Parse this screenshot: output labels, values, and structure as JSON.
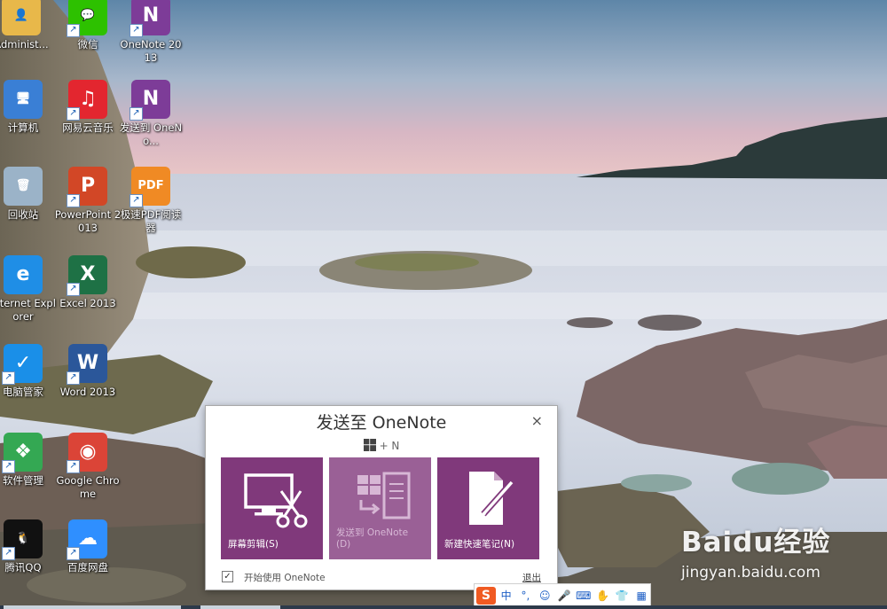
{
  "desktop_icons": [
    {
      "id": "admin",
      "label": "Administ...",
      "icon": "user-folder-icon",
      "color": "#e8b84a",
      "shortcut": false
    },
    {
      "id": "wechat",
      "label": "微信",
      "icon": "wechat-icon",
      "color": "#2dc100",
      "shortcut": true
    },
    {
      "id": "onenote",
      "label": "OneNote 2013",
      "icon": "onenote-icon",
      "color": "#7d3c98",
      "shortcut": true
    },
    {
      "id": "computer",
      "label": "计算机",
      "icon": "computer-icon",
      "color": "#3a7fd5",
      "shortcut": false
    },
    {
      "id": "netease",
      "label": "网易云音乐",
      "icon": "netease-music-icon",
      "color": "#e3262f",
      "shortcut": true
    },
    {
      "id": "sendto",
      "label": "发送到 OneNo...",
      "icon": "send-to-onenote-icon",
      "color": "#7d3c98",
      "shortcut": true
    },
    {
      "id": "recycle",
      "label": "回收站",
      "icon": "recycle-bin-icon",
      "color": "#9bb3c8",
      "shortcut": false
    },
    {
      "id": "ppt",
      "label": "PowerPoint 2013",
      "icon": "powerpoint-icon",
      "color": "#d24726",
      "shortcut": true
    },
    {
      "id": "pdf",
      "label": "极速PDF阅读器",
      "icon": "pdf-reader-icon",
      "color": "#f08a24",
      "shortcut": true
    },
    {
      "id": "ie",
      "label": "Internet Explorer",
      "icon": "internet-explorer-icon",
      "color": "#1f8ee6",
      "shortcut": false
    },
    {
      "id": "excel",
      "label": "Excel 2013",
      "icon": "excel-icon",
      "color": "#1e7145",
      "shortcut": true
    },
    {
      "id": "guard",
      "label": "电脑管家",
      "icon": "pc-manager-icon",
      "color": "#1a8fe8",
      "shortcut": true
    },
    {
      "id": "word",
      "label": "Word 2013",
      "icon": "word-icon",
      "color": "#2b579a",
      "shortcut": true
    },
    {
      "id": "softmgr",
      "label": "软件管理",
      "icon": "software-manager-icon",
      "color": "#34a853",
      "shortcut": true
    },
    {
      "id": "chrome",
      "label": "Google Chrome",
      "icon": "chrome-icon",
      "color": "#db4437",
      "shortcut": true
    },
    {
      "id": "qq",
      "label": "腾讯QQ",
      "icon": "qq-icon",
      "color": "#111111",
      "shortcut": true
    },
    {
      "id": "baidupan",
      "label": "百度网盘",
      "icon": "baidu-netdisk-icon",
      "color": "#2f8fff",
      "shortcut": true
    }
  ],
  "dialog": {
    "title": "发送至 OneNote",
    "close_glyph": "×",
    "hotkey": "+ N",
    "accent": "#80397b",
    "tiles": [
      {
        "label": "屏幕剪辑(S)",
        "icon": "screen-clip-icon",
        "enabled": true
      },
      {
        "label": "发送到 OneNote\n(D)",
        "icon": "send-to-onenote-icon",
        "enabled": false
      },
      {
        "label": "新建快速笔记(N)",
        "icon": "quick-note-icon",
        "enabled": true
      }
    ],
    "start_checked": true,
    "check_glyph": "✓",
    "start_label": "开始使用 OneNote",
    "exit_label": "退出"
  },
  "ime": {
    "logo": "S",
    "items": [
      "中",
      "°,",
      "☺",
      "🎤",
      "⌨",
      "✋",
      "👕",
      "▦"
    ]
  },
  "watermark": {
    "brand": "Baidu经验",
    "url": "jingyan.baidu.com"
  }
}
